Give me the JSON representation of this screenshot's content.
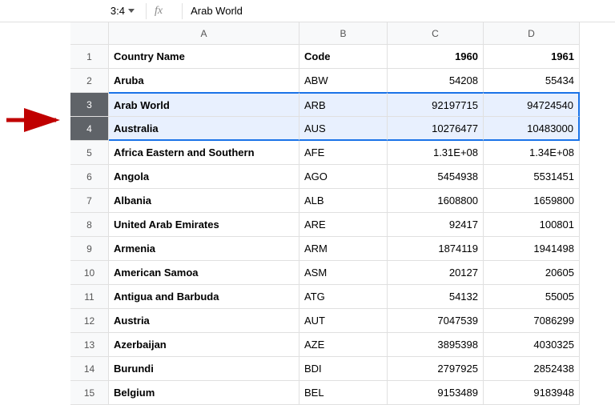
{
  "name_box": "3:4",
  "fx_label": "fx",
  "formula_content": "Arab World",
  "columns": [
    "A",
    "B",
    "C",
    "D"
  ],
  "header_row": {
    "country": "Country Name",
    "code": "Code",
    "y1960": "1960",
    "y1961": "1961"
  },
  "rows": [
    {
      "n": "1",
      "a": "Country Name",
      "b": "Code",
      "c": "1960",
      "d": "1961",
      "is_header": true
    },
    {
      "n": "2",
      "a": "Aruba",
      "b": "ABW",
      "c": "54208",
      "d": "55434"
    },
    {
      "n": "3",
      "a": "Arab World",
      "b": "ARB",
      "c": "92197715",
      "d": "94724540",
      "selected": true
    },
    {
      "n": "4",
      "a": "Australia",
      "b": "AUS",
      "c": "10276477",
      "d": "10483000",
      "selected": true
    },
    {
      "n": "5",
      "a": "Africa Eastern and Southern",
      "b": "AFE",
      "c": "1.31E+08",
      "d": "1.34E+08"
    },
    {
      "n": "6",
      "a": "Angola",
      "b": "AGO",
      "c": "5454938",
      "d": "5531451"
    },
    {
      "n": "7",
      "a": "Albania",
      "b": "ALB",
      "c": "1608800",
      "d": "1659800"
    },
    {
      "n": "8",
      "a": "United Arab Emirates",
      "b": "ARE",
      "c": "92417",
      "d": "100801"
    },
    {
      "n": "9",
      "a": "Armenia",
      "b": "ARM",
      "c": "1874119",
      "d": "1941498"
    },
    {
      "n": "10",
      "a": "American Samoa",
      "b": "ASM",
      "c": "20127",
      "d": "20605"
    },
    {
      "n": "11",
      "a": "Antigua and Barbuda",
      "b": "ATG",
      "c": "54132",
      "d": "55005"
    },
    {
      "n": "12",
      "a": "Austria",
      "b": "AUT",
      "c": "7047539",
      "d": "7086299"
    },
    {
      "n": "13",
      "a": "Azerbaijan",
      "b": "AZE",
      "c": "3895398",
      "d": "4030325"
    },
    {
      "n": "14",
      "a": "Burundi",
      "b": "BDI",
      "c": "2797925",
      "d": "2852438"
    },
    {
      "n": "15",
      "a": "Belgium",
      "b": "BEL",
      "c": "9153489",
      "d": "9183948"
    }
  ]
}
